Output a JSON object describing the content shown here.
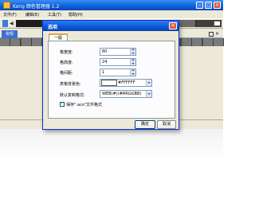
{
  "app": {
    "title": "Kong 颜色管理器 1.2"
  },
  "menu": {
    "items": [
      "文件(F)",
      "编辑(E)",
      "工具(T)",
      "帮助(H)"
    ]
  },
  "tabs": {
    "active": "常规"
  },
  "colors": {
    "title_bar": "#0a5fd8",
    "close_red": "#e0563a",
    "tab_accent": "#f2a33a"
  },
  "swatches": [
    "#1c1c1c",
    "#3a3a3a",
    "#5a5a5a",
    "#8a6a4a",
    "#4a4a4a",
    "#2a2a2a",
    "#6a6a6a",
    "#3f3f3f"
  ],
  "dialog": {
    "title": "选项",
    "tab": "一般",
    "fields": {
      "cell_width": {
        "label": "格宽度:",
        "value": "60"
      },
      "cell_height": {
        "label": "格高度:",
        "value": "24"
      },
      "cell_gap": {
        "label": "格间距:",
        "value": "1"
      },
      "table_bg": {
        "label": "表格背景色:",
        "value": "#FFFFFF"
      },
      "copy_format": {
        "label": "默认复制格式:",
        "value": "WEB(#)(#RRGGBB)"
      }
    },
    "checkbox": {
      "label": "保存\".aco\"文件格式",
      "checked": true
    },
    "buttons": {
      "ok": "确定",
      "cancel": "取消"
    }
  }
}
